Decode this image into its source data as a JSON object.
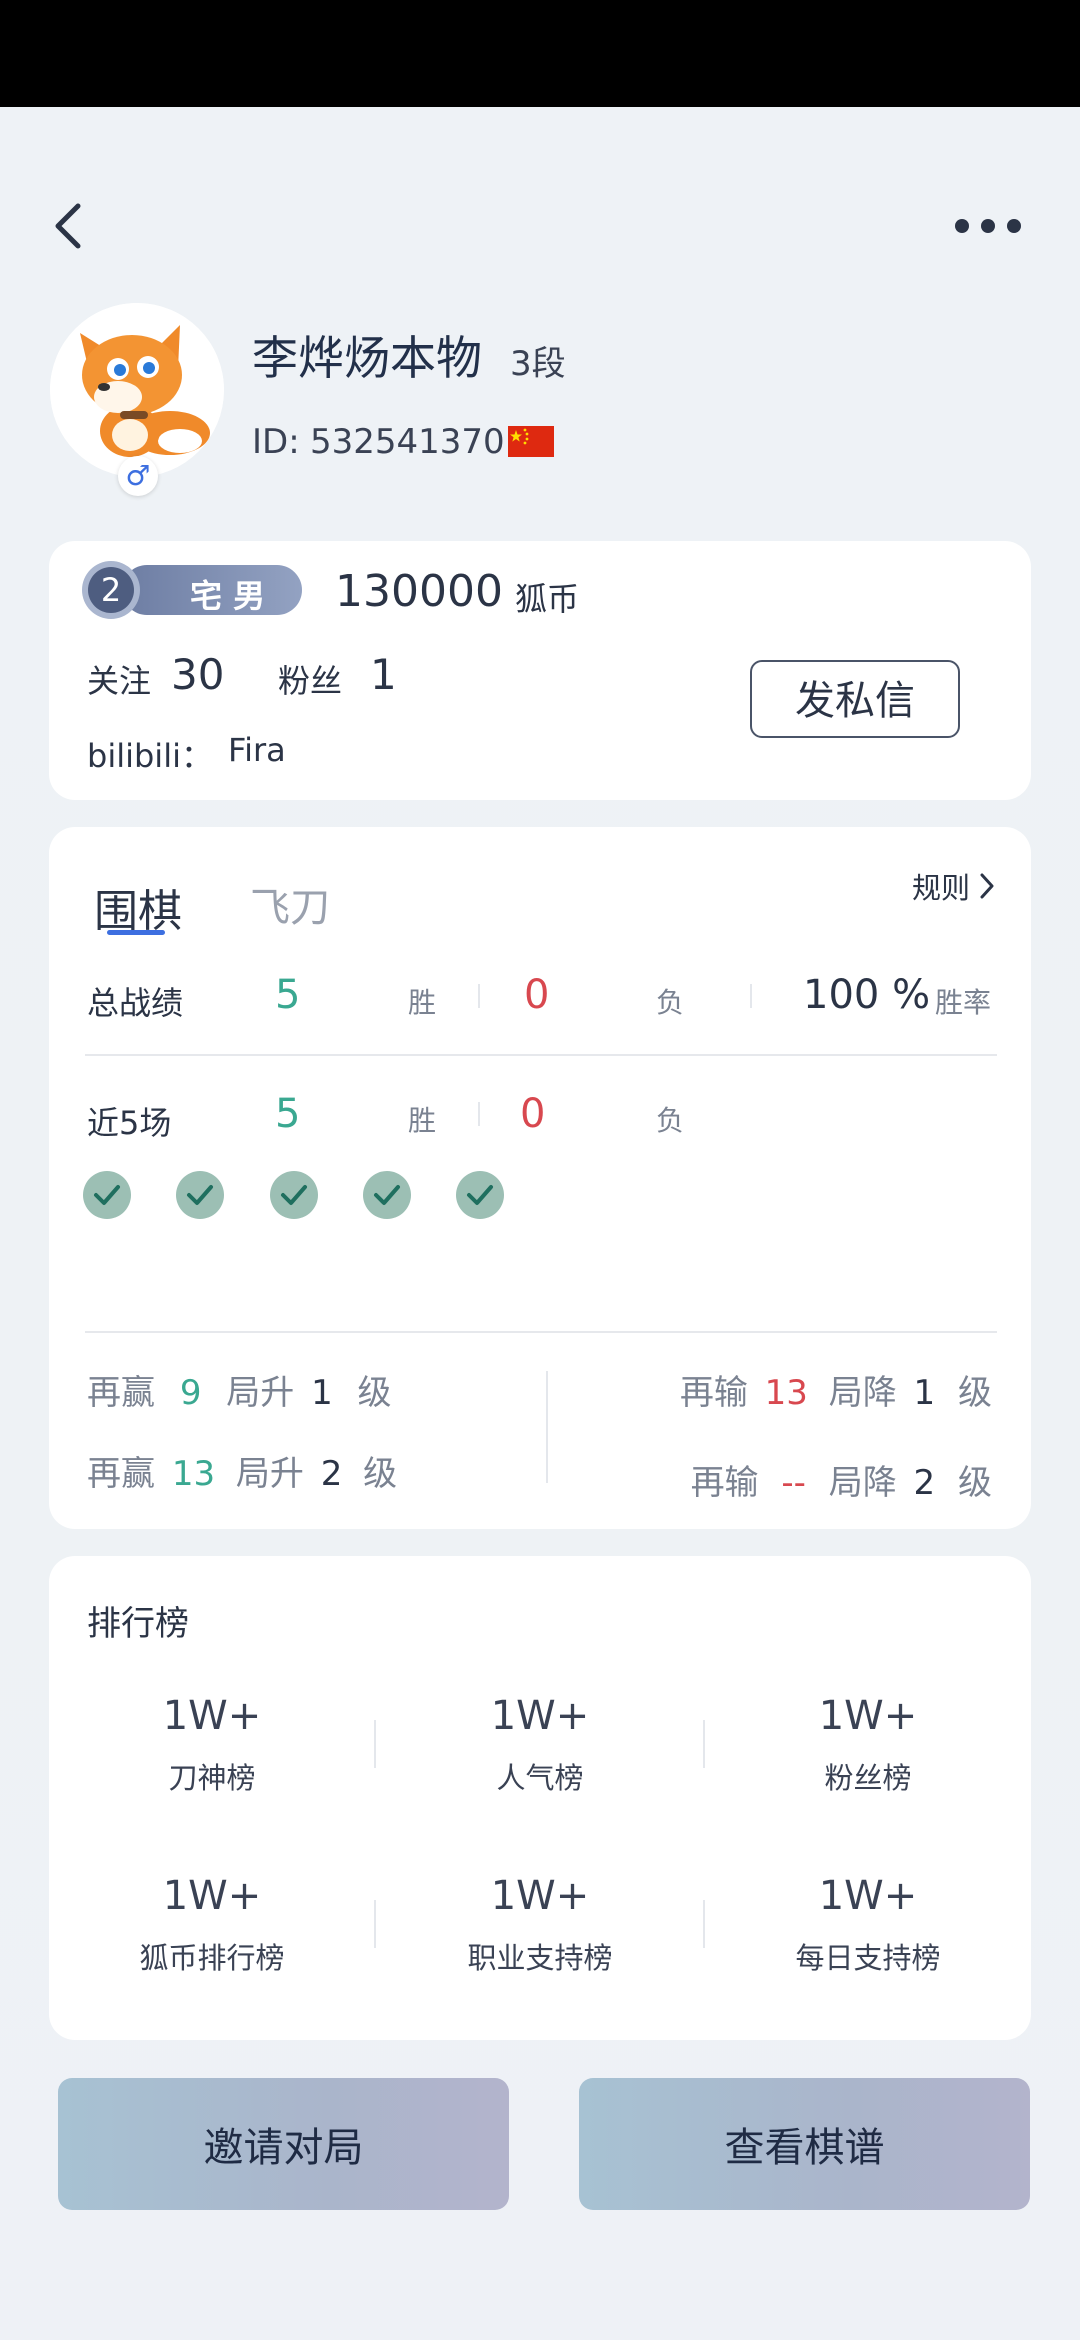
{
  "header": {
    "back_icon": "chevron-left-icon",
    "more_icon": "more-dots-icon"
  },
  "profile": {
    "name": "李烨炀本物",
    "rank": "3段",
    "id_label": "ID:",
    "id_value": "532541370",
    "flag": "china-flag-icon",
    "gender_symbol": "♂",
    "avatar": "fox-avatar"
  },
  "stats_card": {
    "badge_level": "2",
    "badge_title": "宅 男",
    "coins": "130000",
    "coins_unit": "狐币",
    "follow_label": "关注",
    "follow_count": "30",
    "fans_label": "粉丝",
    "fans_count": "1",
    "bilibili_label": "bilibili：",
    "bilibili_name": "Fira",
    "message_button": "发私信"
  },
  "record": {
    "tabs": [
      {
        "label": "围棋",
        "active": true
      },
      {
        "label": "飞刀",
        "active": false
      }
    ],
    "rules_link": "规则",
    "total_label": "总战绩",
    "total_wins": "5",
    "win_label": "胜",
    "total_losses": "0",
    "loss_label": "负",
    "win_rate": "100 %",
    "win_rate_label": "胜率",
    "recent_label": "近5场",
    "recent_wins": "5",
    "recent_losses": "0",
    "recent_results": [
      "win",
      "win",
      "win",
      "win",
      "win"
    ],
    "promote": [
      {
        "prefix": "再赢",
        "count": "9",
        "middle": "局升",
        "levels": "1",
        "suffix": "级"
      },
      {
        "prefix": "再赢",
        "count": "13",
        "middle": "局升",
        "levels": "2",
        "suffix": "级"
      }
    ],
    "demote": [
      {
        "prefix": "再输",
        "count": "13",
        "middle": "局降",
        "levels": "1",
        "suffix": "级"
      },
      {
        "prefix": "再输",
        "count": "--",
        "middle": "局降",
        "levels": "2",
        "suffix": "级"
      }
    ]
  },
  "leaderboard": {
    "title": "排行榜",
    "items": [
      {
        "value": "1W+",
        "label": "刀神榜"
      },
      {
        "value": "1W+",
        "label": "人气榜"
      },
      {
        "value": "1W+",
        "label": "粉丝榜"
      },
      {
        "value": "1W+",
        "label": "狐币排行榜"
      },
      {
        "value": "1W+",
        "label": "职业支持榜"
      },
      {
        "value": "1W+",
        "label": "每日支持榜"
      }
    ]
  },
  "actions": {
    "invite": "邀请对局",
    "view_records": "查看棋谱"
  },
  "colors": {
    "win": "#3aa891",
    "loss": "#d8484f",
    "accent": "#3d6fe0"
  }
}
